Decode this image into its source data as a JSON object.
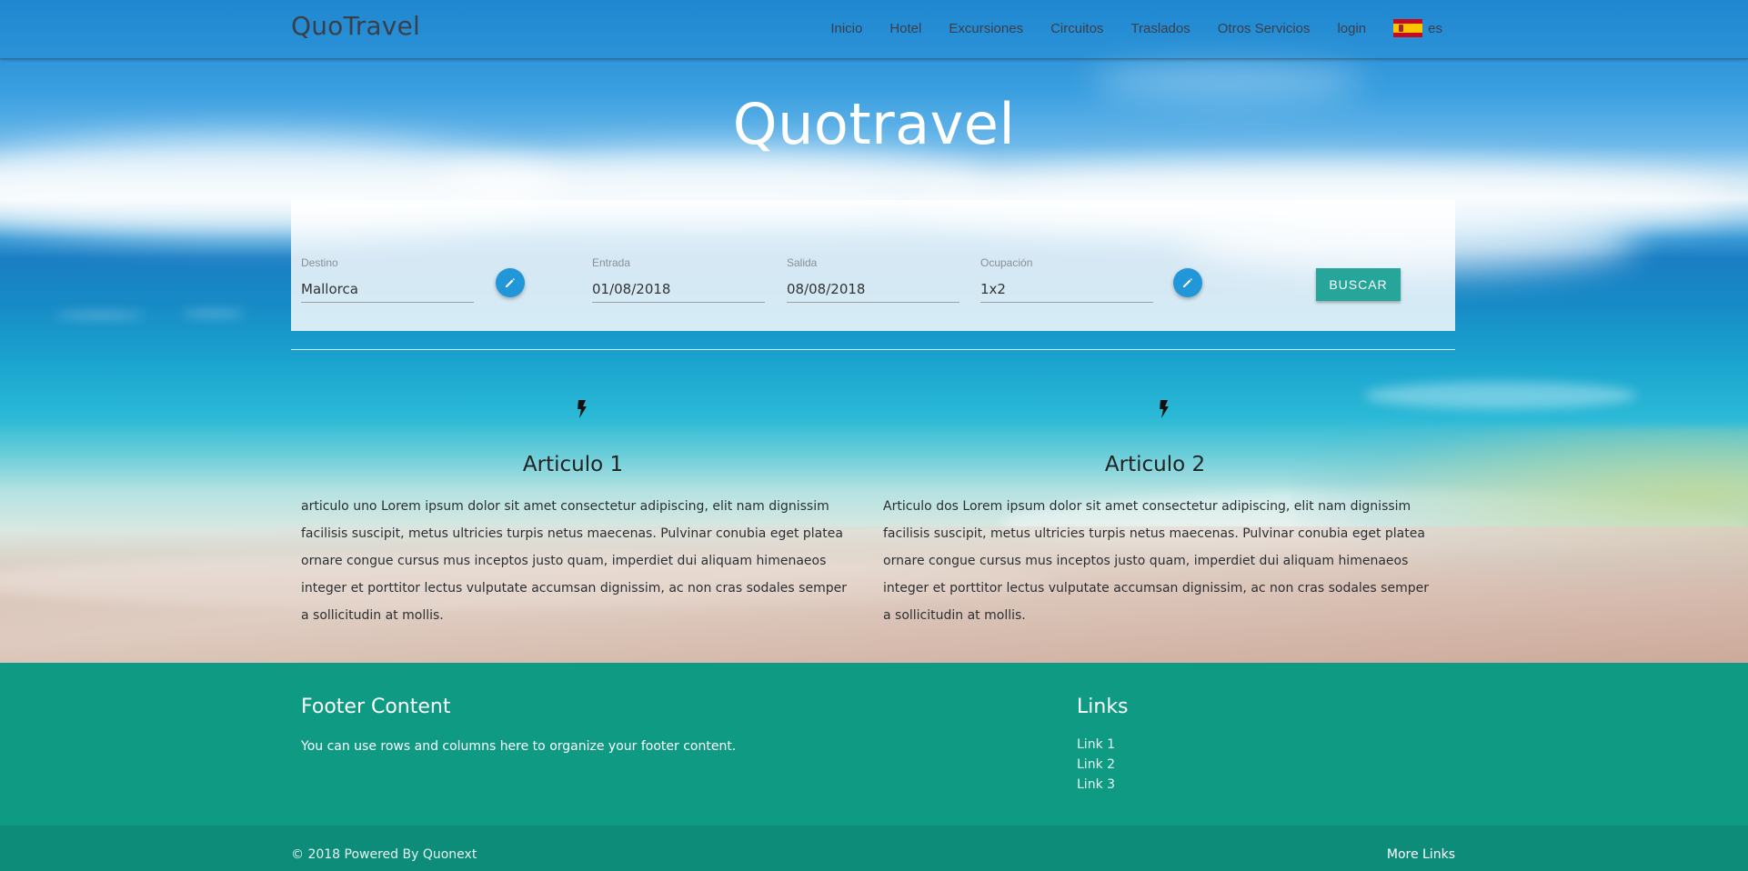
{
  "navbar": {
    "brand": "QuoTravel",
    "items": [
      {
        "label": "Inicio"
      },
      {
        "label": "Hotel"
      },
      {
        "label": "Excursiones"
      },
      {
        "label": "Circuitos"
      },
      {
        "label": "Traslados"
      },
      {
        "label": "Otros Servicios"
      },
      {
        "label": "login"
      }
    ],
    "language": {
      "code": "es",
      "flag_icon": "spain-flag-icon"
    }
  },
  "hero": {
    "title": "Quotravel"
  },
  "search": {
    "destino": {
      "label": "Destino",
      "value": "Mallorca"
    },
    "entrada": {
      "label": "Entrada",
      "value": "01/08/2018"
    },
    "salida": {
      "label": "Salida",
      "value": "08/08/2018"
    },
    "ocupacion": {
      "label": "Ocupación",
      "value": "1x2"
    },
    "submit_label": "BUSCAR",
    "edit_icon": "pencil-icon"
  },
  "articles": [
    {
      "icon": "lightning-bolt-icon",
      "title": "Articulo 1",
      "body": "articulo uno Lorem ipsum dolor sit amet consectetur adipiscing, elit nam dignissim facilisis suscipit, metus ultricies turpis netus maecenas. Pulvinar conubia eget platea ornare congue cursus mus inceptos justo quam, imperdiet dui aliquam himenaeos integer et porttitor lectus vulputate accumsan dignissim, ac non cras sodales semper a sollicitudin at mollis."
    },
    {
      "icon": "lightning-bolt-icon",
      "title": "Articulo 2",
      "body": "Articulo dos Lorem ipsum dolor sit amet consectetur adipiscing, elit nam dignissim facilisis suscipit, metus ultricies turpis netus maecenas. Pulvinar conubia eget platea ornare congue cursus mus inceptos justo quam, imperdiet dui aliquam himenaeos integer et porttitor lectus vulputate accumsan dignissim, ac non cras sodales semper a sollicitudin at mollis."
    }
  ],
  "footer": {
    "heading": "Footer Content",
    "text": "You can use rows and columns here to organize your footer content.",
    "links_heading": "Links",
    "links": [
      {
        "label": "Link 1"
      },
      {
        "label": "Link 2"
      },
      {
        "label": "Link 3"
      }
    ],
    "copyright": "© 2018 Powered By Quonext",
    "more_links": "More Links"
  },
  "colors": {
    "accent": "#26a69a",
    "edit_button": "#2196d9",
    "footer_bg": "#0f9a84",
    "footer_bottom_bg": "#0d8c79"
  }
}
